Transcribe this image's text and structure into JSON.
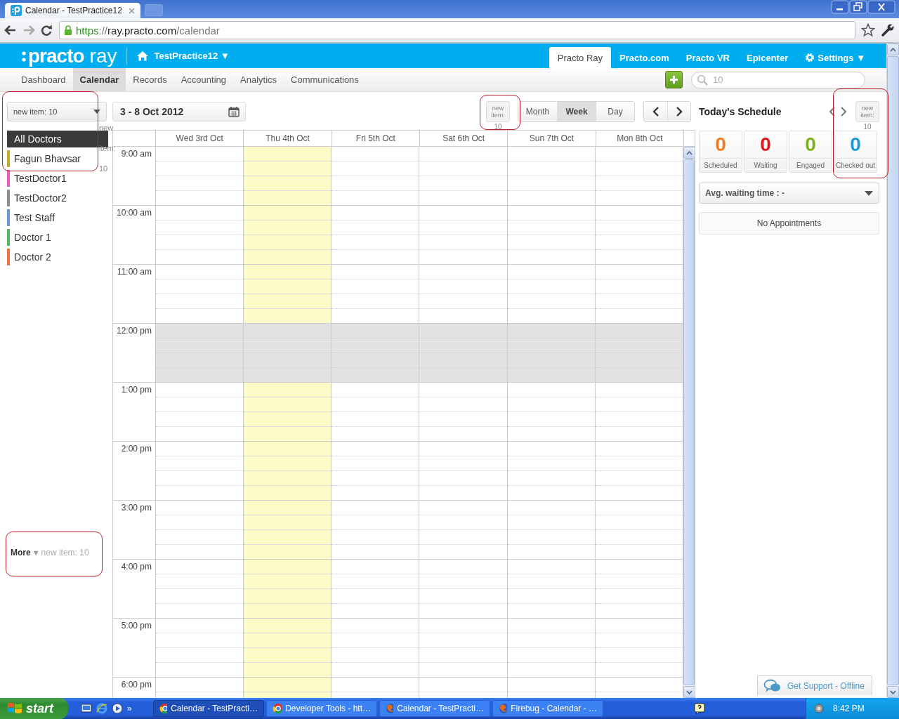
{
  "browser": {
    "tab_title": "Calendar - TestPractice12",
    "url": [
      {
        "kind": "scheme",
        "text": "https"
      },
      {
        "kind": "sep",
        "text": "://"
      },
      {
        "kind": "host",
        "text": "ray.practo.com"
      },
      {
        "kind": "path",
        "text": "/calendar"
      }
    ]
  },
  "header": {
    "logo_main": "practo",
    "logo_sub": "ray",
    "practice": "TestPractice12 ▼",
    "links": [
      {
        "label": "Practo Ray",
        "selected": true
      },
      {
        "label": "Practo.com",
        "selected": false
      },
      {
        "label": "Practo VR",
        "selected": false
      },
      {
        "label": "Epicenter",
        "selected": false
      },
      {
        "label": "Settings ▼",
        "selected": false,
        "kind": "settings"
      }
    ]
  },
  "nav": {
    "items": [
      {
        "label": "Dashboard",
        "selected": false
      },
      {
        "label": "Calendar",
        "selected": true
      },
      {
        "label": "Records",
        "selected": false
      },
      {
        "label": "Accounting",
        "selected": false
      },
      {
        "label": "Analytics",
        "selected": false
      },
      {
        "label": "Communications",
        "selected": false
      }
    ],
    "search": {
      "placeholder": "10"
    }
  },
  "sidebar": {
    "dropdown": "new item: 10",
    "alt_text": "new item: 10",
    "doctors": [
      {
        "name": "All Doctors",
        "selected": true
      },
      {
        "name": "Fagun Bhavsar",
        "selected": false,
        "color": "#c9ab2a"
      },
      {
        "name": "TestDoctor1",
        "selected": false,
        "color": "#e55fc6"
      },
      {
        "name": "TestDoctor2",
        "selected": false,
        "color": "#8d8d97"
      },
      {
        "name": "Test Staff",
        "selected": false,
        "color": "#6b9acf"
      },
      {
        "name": "Doctor 1",
        "selected": false,
        "color": "#55b860"
      },
      {
        "name": "Doctor 2",
        "selected": false,
        "color": "#f07040"
      }
    ],
    "more": "More",
    "more_arrow": "▼",
    "more_note": "new item: 10"
  },
  "calendar": {
    "date_range": "3 - 8 Oct 2012",
    "image_button": {
      "alt": "new item:",
      "caption": "10"
    },
    "views": [
      {
        "label": "Month",
        "selected": false
      },
      {
        "label": "Week",
        "selected": true
      },
      {
        "label": "Day",
        "selected": false
      }
    ],
    "days": [
      {
        "label": "Wed 3rd Oct",
        "today": false
      },
      {
        "label": "Thu 4th Oct",
        "today": true
      },
      {
        "label": "Fri 5th Oct",
        "today": false
      },
      {
        "label": "Sat 6th Oct",
        "today": false
      },
      {
        "label": "Sun 7th Oct",
        "today": false
      },
      {
        "label": "Mon 8th Oct",
        "today": false
      }
    ],
    "hours": [
      {
        "label": "9:00 am",
        "break": false
      },
      {
        "label": "10:00 am",
        "break": false
      },
      {
        "label": "11:00 am",
        "break": false
      },
      {
        "label": "12:00 pm",
        "break": true
      },
      {
        "label": "1:00 pm",
        "break": false
      },
      {
        "label": "2:00 pm",
        "break": false
      },
      {
        "label": "3:00 pm",
        "break": false
      },
      {
        "label": "4:00 pm",
        "break": false
      },
      {
        "label": "5:00 pm",
        "break": false
      },
      {
        "label": "6:00 pm",
        "break": false
      }
    ]
  },
  "schedule": {
    "title": "Today's Schedule",
    "image_button": {
      "alt": "new item:",
      "caption": "10"
    },
    "stats": [
      {
        "value": "0",
        "label": "Scheduled",
        "color": "#f47a20"
      },
      {
        "value": "0",
        "label": "Waiting",
        "color": "#e3131b"
      },
      {
        "value": "0",
        "label": "Engaged",
        "color": "#7bb01b"
      },
      {
        "value": "0",
        "label": "Checked out",
        "color": "#1b9ad7"
      }
    ],
    "avg_waiting": "Avg. waiting time : -",
    "empty": "No Appointments",
    "support": "Get Support - Offline"
  },
  "taskbar": {
    "start": "start",
    "overflow": "»",
    "tasks": [
      {
        "label": "Calendar - TestPracti…",
        "selected": true,
        "kind": "chrome"
      },
      {
        "label": "Developer Tools - htt…",
        "selected": false,
        "kind": "chrome"
      },
      {
        "label": "Calendar - TestPracti…",
        "selected": false,
        "kind": "firefox"
      },
      {
        "label": "Firebug - Calendar - …",
        "selected": false,
        "kind": "firefox"
      }
    ],
    "clock": "8:42 PM"
  }
}
